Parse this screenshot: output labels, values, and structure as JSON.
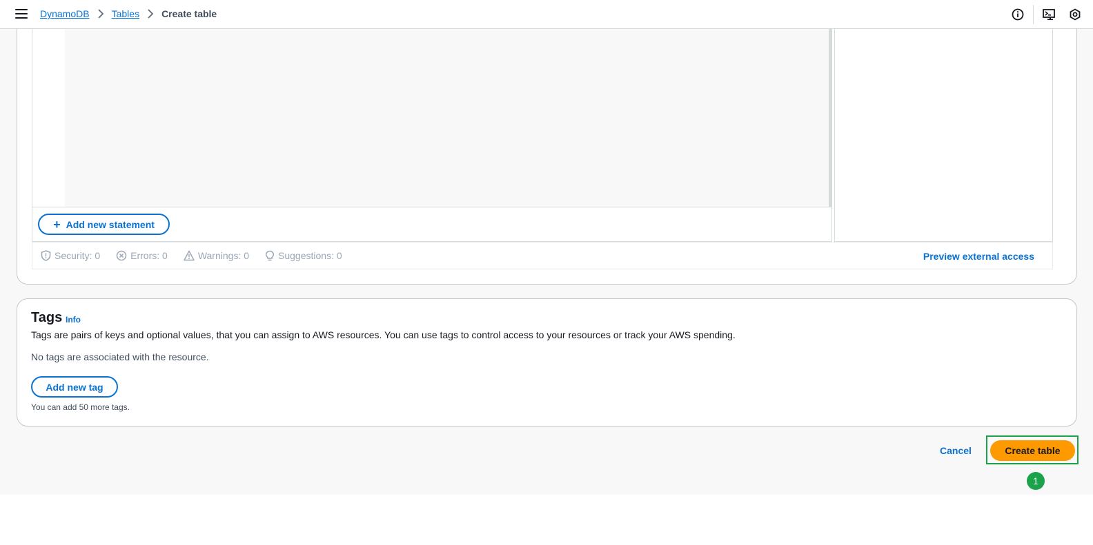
{
  "breadcrumb": {
    "items": [
      {
        "label": "DynamoDB"
      },
      {
        "label": "Tables"
      }
    ],
    "current": "Create table"
  },
  "policy": {
    "add_statement_label": "Add new statement",
    "status": {
      "security": "Security: 0",
      "errors": "Errors: 0",
      "warnings": "Warnings: 0",
      "suggestions": "Suggestions: 0"
    },
    "preview_label": "Preview external access"
  },
  "tags": {
    "title": "Tags",
    "info": "Info",
    "description": "Tags are pairs of keys and optional values, that you can assign to AWS resources. You can use tags to control access to your resources or track your AWS spending.",
    "empty": "No tags are associated with the resource.",
    "add_label": "Add new tag",
    "hint": "You can add 50 more tags."
  },
  "footer": {
    "cancel": "Cancel",
    "create": "Create table"
  },
  "marker": "1",
  "icons": {
    "menu": "hamburger-menu-icon",
    "info": "info-icon",
    "cloudshell": "cloudshell-icon",
    "settings": "hexagon-settings-icon"
  },
  "colors": {
    "accent": "#0972d3",
    "primary_button": "#ff9900",
    "highlight": "#1aa34a"
  }
}
